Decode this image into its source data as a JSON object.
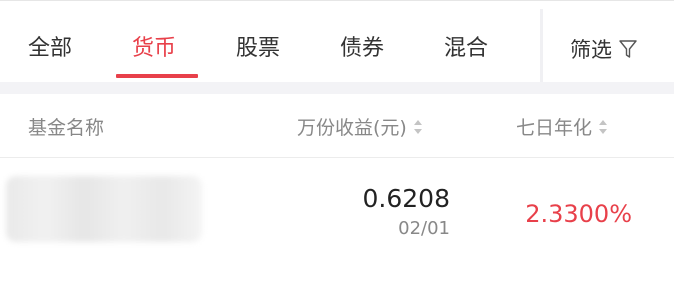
{
  "tabs": [
    {
      "label": "全部",
      "active": false
    },
    {
      "label": "货币",
      "active": true
    },
    {
      "label": "股票",
      "active": false
    },
    {
      "label": "债券",
      "active": false
    },
    {
      "label": "混合",
      "active": false
    }
  ],
  "filter": {
    "label": "筛选",
    "icon": "funnel-icon"
  },
  "table_header": {
    "name": "基金名称",
    "per_10k_income": "万份收益(元)",
    "seven_day_annualized": "七日年化",
    "sort_icon": "sort-updown-icon"
  },
  "rows": [
    {
      "per_10k_income": "0.6208",
      "date": "02/01",
      "seven_day_annualized": "2.3300%"
    }
  ],
  "colors": {
    "accent": "#e8404a",
    "text": "#333333",
    "muted": "#888888",
    "band": "#f3f3f6"
  }
}
